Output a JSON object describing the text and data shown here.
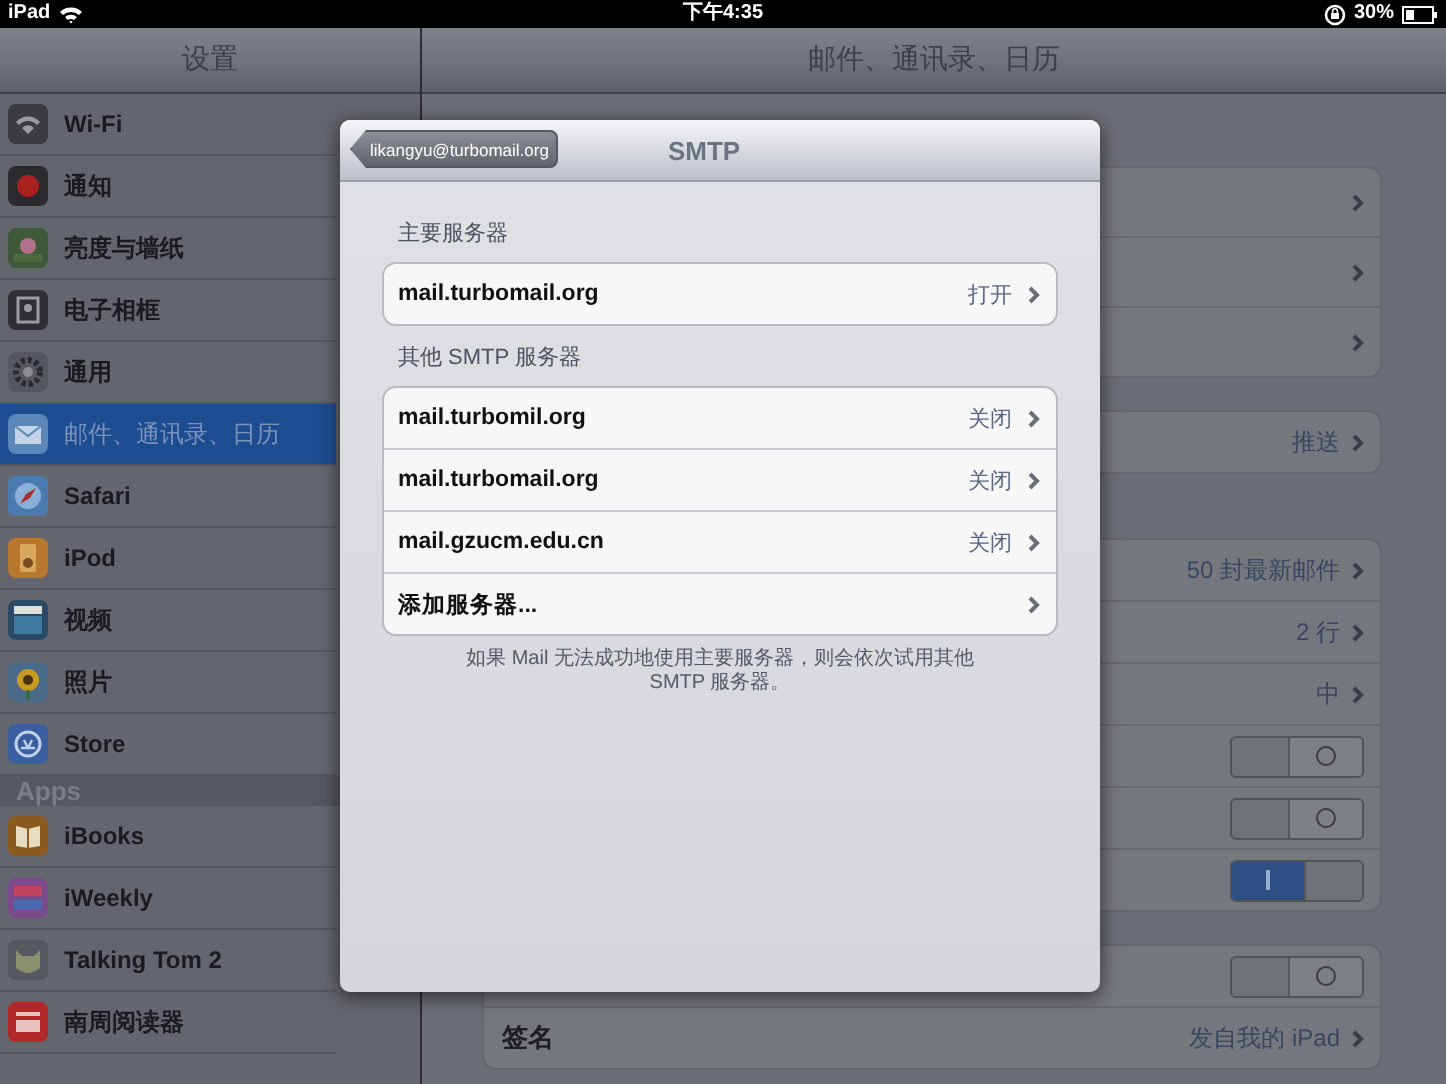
{
  "status_bar": {
    "device": "iPad",
    "time": "下午4:35",
    "battery": "30%"
  },
  "sidebar": {
    "title": "设置",
    "sections": [
      {
        "items": [
          {
            "label": "Wi-Fi",
            "selected": false
          },
          {
            "label": "通知",
            "selected": false
          },
          {
            "label": "亮度与墙纸",
            "selected": false
          },
          {
            "label": "电子相框",
            "selected": false
          },
          {
            "label": "通用",
            "selected": false
          },
          {
            "label": "邮件、通讯录、日历",
            "selected": true
          },
          {
            "label": "Safari",
            "selected": false
          },
          {
            "label": "iPod",
            "selected": false
          },
          {
            "label": "视频",
            "selected": false
          },
          {
            "label": "照片",
            "selected": false
          },
          {
            "label": "Store",
            "selected": false
          }
        ]
      },
      {
        "header": "Apps",
        "items": [
          {
            "label": "iBooks",
            "selected": false
          },
          {
            "label": "iWeekly",
            "selected": false
          },
          {
            "label": "Talking Tom 2",
            "selected": false
          },
          {
            "label": "南周阅读器",
            "selected": false
          }
        ]
      }
    ]
  },
  "detail": {
    "title": "邮件、通讯录、日历",
    "groups": [
      {
        "rows": [
          {
            "kind": "link"
          },
          {
            "kind": "link"
          },
          {
            "kind": "link"
          }
        ]
      },
      {
        "rows": [
          {
            "kind": "link",
            "value": "推送"
          }
        ]
      },
      {
        "rows": [
          {
            "kind": "link",
            "value": "50 封最新邮件"
          },
          {
            "kind": "link",
            "value": "2 行"
          },
          {
            "kind": "link",
            "value": "中"
          },
          {
            "kind": "toggle",
            "on": false
          },
          {
            "kind": "toggle",
            "on": false
          },
          {
            "kind": "toggle",
            "on": true
          }
        ]
      },
      {
        "rows": [
          {
            "kind": "toggle",
            "on": false
          },
          {
            "kind": "link",
            "label": "签名",
            "value": "发自我的 iPad"
          }
        ]
      }
    ]
  },
  "popover": {
    "back": "likangyu@turbomail.org",
    "title": "SMTP",
    "sections": [
      {
        "header": "主要服务器",
        "rows": [
          {
            "label": "mail.turbomail.org",
            "value": "打开"
          }
        ]
      },
      {
        "header": "其他 SMTP 服务器",
        "rows": [
          {
            "label": "mail.turbomil.org",
            "value": "关闭"
          },
          {
            "label": "mail.turbomail.org",
            "value": "关闭"
          },
          {
            "label": "mail.gzucm.edu.cn",
            "value": "关闭"
          },
          {
            "label": "添加服务器..."
          }
        ]
      }
    ],
    "footer": "如果 Mail 无法成功地使用主要服务器，则会依次试用其他 SMTP 服务器。"
  }
}
